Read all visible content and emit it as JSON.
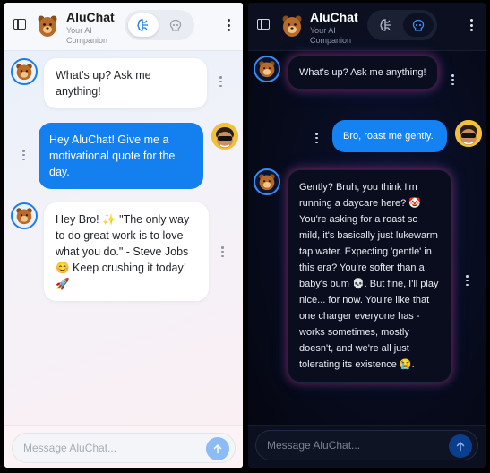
{
  "app": {
    "name": "AluChat",
    "subtitle": "Your AI Companion"
  },
  "input": {
    "placeholder": "Message AluChat..."
  },
  "light_panel": {
    "messages": [
      {
        "role": "bot",
        "text": "What's up? Ask me anything!"
      },
      {
        "role": "user",
        "text": "Hey AluChat! Give me a motivational quote for the day."
      },
      {
        "role": "bot",
        "text": "Hey Bro! ✨ \"The only way to do great work is to love what you do.\" - Steve Jobs 😊 Keep crushing it today! 🚀"
      }
    ]
  },
  "dark_panel": {
    "messages": [
      {
        "role": "bot",
        "text": "What's up? Ask me anything!"
      },
      {
        "role": "user",
        "text": "Bro, roast me gently."
      },
      {
        "role": "bot",
        "text": "Gently? Bruh, you think I'm running a daycare here? 🤡 You're asking for a roast so mild, it's basically just lukewarm tap water. Expecting 'gentle' in this era? You're softer than a baby's bum 💀. But fine, I'll play nice... for now. You're like that one charger everyone has - works sometimes, mostly doesn't, and we're all just tolerating its existence 😭."
      }
    ]
  },
  "colors": {
    "accent": "#1480f0",
    "dark_glow": "#dc286e",
    "light_bg": "#eef2f8",
    "dark_bg": "#070b1c"
  },
  "icons": {
    "sidebar": "sidebar-toggle-icon",
    "logo": "bear-mascot-logo",
    "mode_a": "brain-circuit-icon",
    "mode_b": "skull-icon",
    "more": "kebab-menu-icon",
    "send": "arrow-up-icon"
  }
}
